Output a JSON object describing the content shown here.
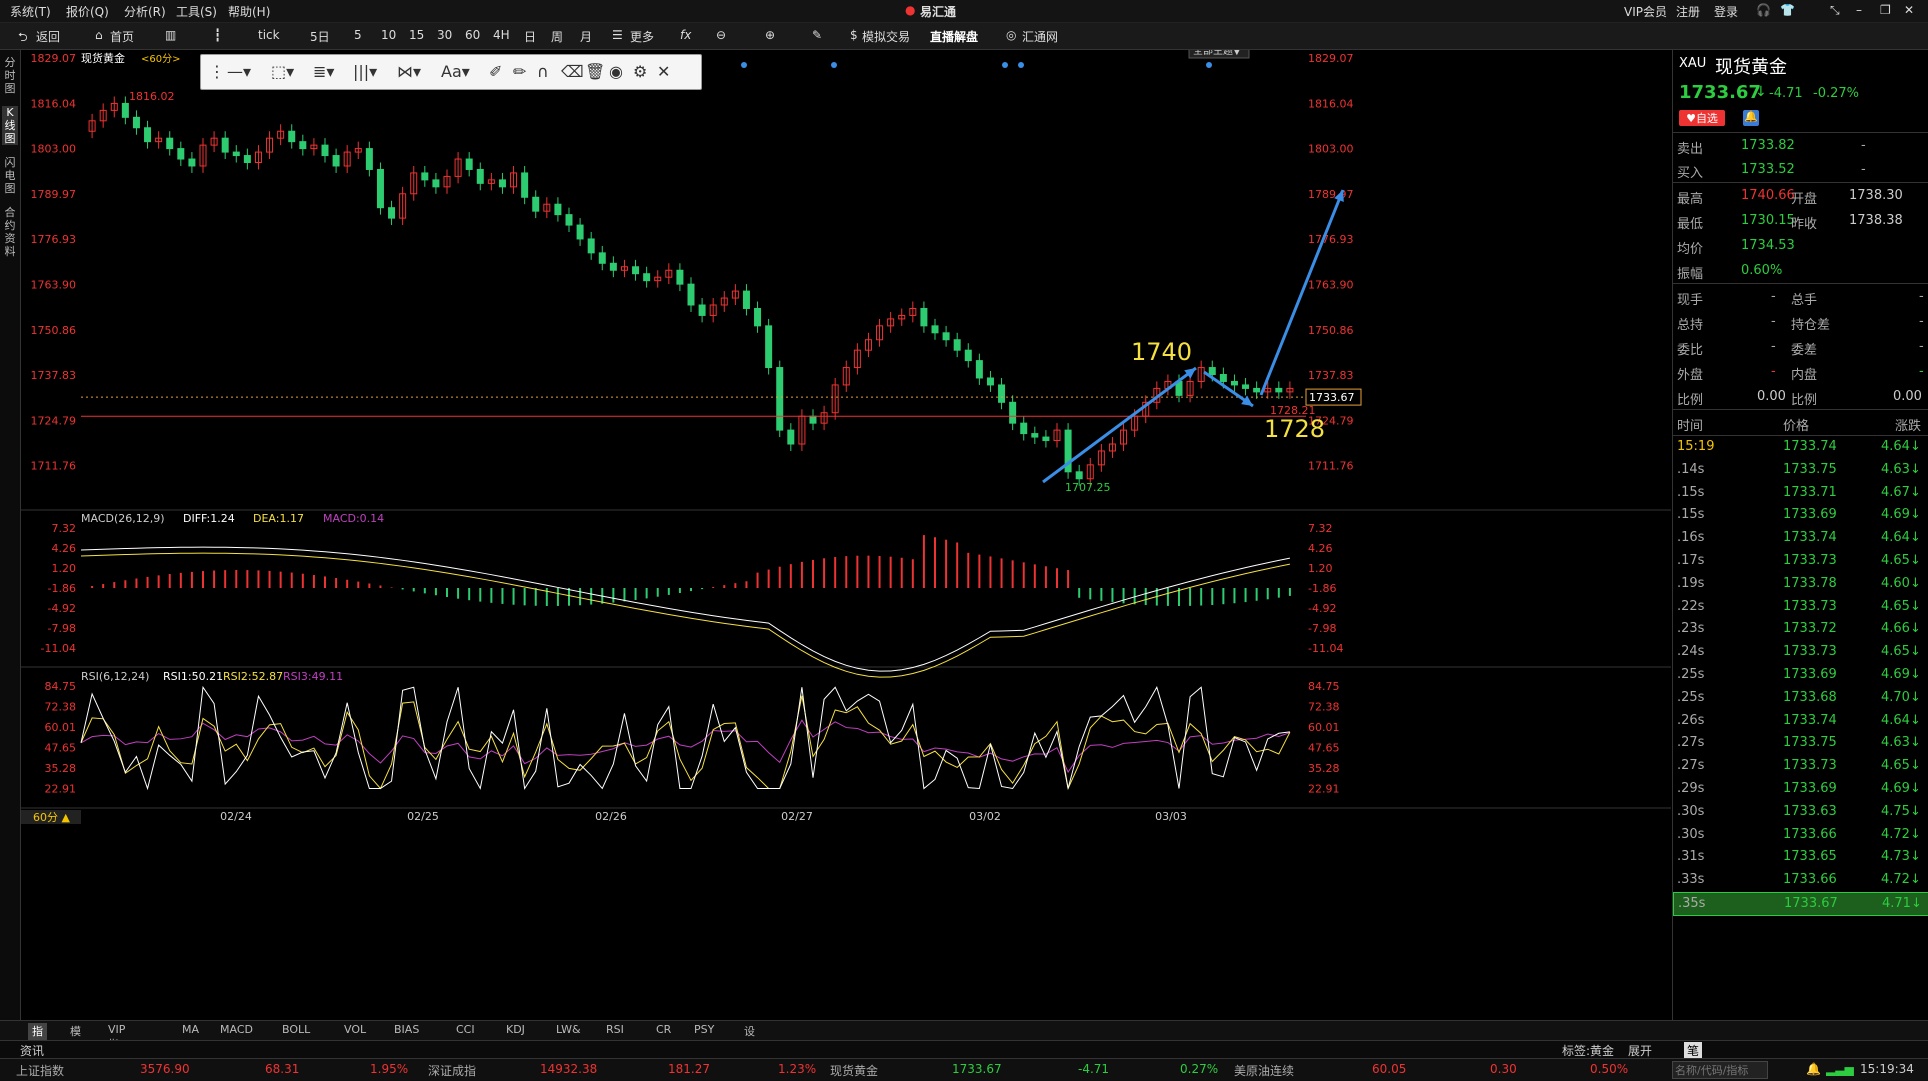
{
  "menubar": {
    "items": [
      "系统(T)",
      "报价(Q)",
      "分析(R)",
      "工具(S)",
      "帮助(H)"
    ],
    "app_title": "易汇通",
    "vip": "VIP会员",
    "register": "注册",
    "login": "登录"
  },
  "toolbar": {
    "back": "返回",
    "home": "首页",
    "tick": "tick",
    "periods": [
      "5日",
      "5",
      "10",
      "15",
      "30",
      "60",
      "4H",
      "日",
      "周",
      "月"
    ],
    "more": "更多",
    "sim_trade": "模拟交易",
    "live_analysis": "直播解盘",
    "huitong": "汇通网"
  },
  "chart": {
    "title": "现货黄金",
    "period_tag": "<60分>",
    "topic": "全部主题▼",
    "price_axis": [
      "1829.07",
      "1816.04",
      "1803.00",
      "1789.97",
      "1776.93",
      "1763.90",
      "1750.86",
      "1737.83",
      "1724.79",
      "1711.76"
    ],
    "high_label": "1816.02",
    "low_label": "1707.25",
    "current_price": "1733.67",
    "line_price": "1728.21",
    "annotations": {
      "upper": "1740",
      "lower": "1728"
    },
    "dates": [
      "02/24",
      "02/25",
      "02/26",
      "02/27",
      "03/02",
      "03/03"
    ],
    "macd": {
      "title": "MACD(26,12,9)",
      "diff": "DIFF:1.24",
      "dea": "DEA:1.17",
      "macd": "MACD:0.14",
      "axis": [
        "7.32",
        "4.26",
        "1.20",
        "-1.86",
        "-4.92",
        "-7.98",
        "-11.04"
      ]
    },
    "rsi": {
      "title": "RSI(6,12,24)",
      "rsi1": "RSI1:50.21",
      "rsi2": "RSI2:52.87",
      "rsi3": "RSI3:49.11",
      "axis": [
        "84.75",
        "72.38",
        "60.01",
        "47.65",
        "35.28",
        "22.91"
      ]
    },
    "period_select": "60分 ▲"
  },
  "indicator_tabs": [
    "指标",
    "模板",
    "VIP指标",
    "MA",
    "MACD",
    "BOLL",
    "VOL",
    "BIAS",
    "CCI",
    "KDJ",
    "LW&",
    "RSI",
    "CR",
    "PSY",
    "设置"
  ],
  "right": {
    "code": "XAU",
    "name": "现货黄金",
    "price": "1733.67",
    "change": "-4.71",
    "pct": "-0.27%",
    "watch": "自选",
    "sell": "1733.82",
    "buy": "1733.52",
    "high": "1740.66",
    "open": "1738.30",
    "low": "1730.15",
    "prev_close": "1738.38",
    "avg": "1734.53",
    "amplitude": "0.60%",
    "labels": {
      "sell": "卖出",
      "buy": "买入",
      "high": "最高",
      "open": "开盘",
      "low": "最低",
      "prev": "昨收",
      "avg": "均价",
      "amp": "振幅",
      "now_hand": "现手",
      "total_hand": "总手",
      "total_hold": "总持",
      "hold_diff": "持仓差",
      "commission_ratio": "委比",
      "commission_diff": "委差",
      "outer": "外盘",
      "inner": "内盘",
      "ratio": "比例",
      "time": "时间",
      "price": "价格",
      "change": "涨跌"
    },
    "ratio1": "0.00",
    "ratio2": "0.00",
    "dash": "-",
    "ticks": [
      [
        "15:19",
        "1733.74",
        "4.64"
      ],
      [
        ".14s",
        "1733.75",
        "4.63"
      ],
      [
        ".15s",
        "1733.71",
        "4.67"
      ],
      [
        ".15s",
        "1733.69",
        "4.69"
      ],
      [
        ".16s",
        "1733.74",
        "4.64"
      ],
      [
        ".17s",
        "1733.73",
        "4.65"
      ],
      [
        ".19s",
        "1733.78",
        "4.60"
      ],
      [
        ".22s",
        "1733.73",
        "4.65"
      ],
      [
        ".23s",
        "1733.72",
        "4.66"
      ],
      [
        ".24s",
        "1733.73",
        "4.65"
      ],
      [
        ".25s",
        "1733.69",
        "4.69"
      ],
      [
        ".25s",
        "1733.68",
        "4.70"
      ],
      [
        ".26s",
        "1733.74",
        "4.64"
      ],
      [
        ".27s",
        "1733.75",
        "4.63"
      ],
      [
        ".27s",
        "1733.73",
        "4.65"
      ],
      [
        ".29s",
        "1733.69",
        "4.69"
      ],
      [
        ".30s",
        "1733.63",
        "4.75"
      ],
      [
        ".30s",
        "1733.66",
        "4.72"
      ],
      [
        ".31s",
        "1733.65",
        "4.73"
      ],
      [
        ".33s",
        "1733.66",
        "4.72"
      ],
      [
        ".35s",
        "1733.67",
        "4.71"
      ]
    ]
  },
  "bottom": {
    "news": "资讯",
    "tag": "标签:黄金",
    "expand": "展开",
    "pen": "笔",
    "search_ph": "名称/代码/指标"
  },
  "status": {
    "items": [
      [
        "上证指数",
        "3576.90",
        "68.31",
        "1.95%"
      ],
      [
        "深证成指",
        "14932.38",
        "181.27",
        "1.23%"
      ],
      [
        "现货黄金",
        "1733.67",
        "-4.71",
        "0.27%"
      ],
      [
        "美原油连续",
        "60.05",
        "0.30",
        "0.50%"
      ]
    ],
    "time": "15:19:34"
  }
}
